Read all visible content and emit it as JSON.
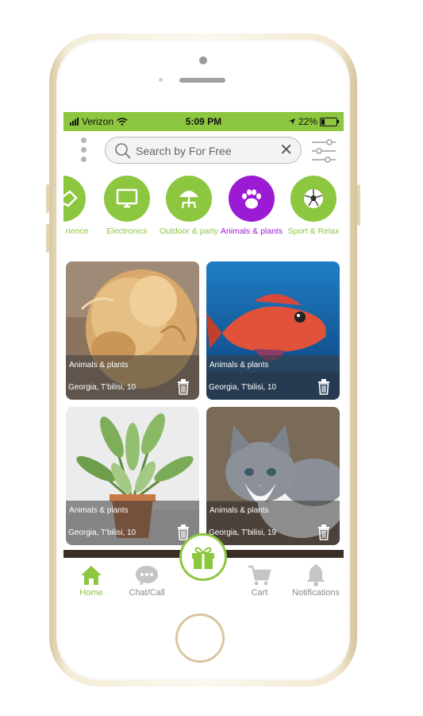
{
  "status_bar": {
    "carrier": "Verizon",
    "time": "5:09 PM",
    "battery": "22%"
  },
  "search": {
    "placeholder": "Search by For Free"
  },
  "categories": [
    {
      "label": "edge & rience",
      "icon": "handshake-icon",
      "active": false
    },
    {
      "label": "Electronics",
      "icon": "monitor-icon",
      "active": false
    },
    {
      "label": "Outdoor & party",
      "icon": "parasol-table-icon",
      "active": false
    },
    {
      "label": "Animals & plants",
      "icon": "paw-icon",
      "active": true
    },
    {
      "label": "Sport & Relax",
      "icon": "soccer-ball-icon",
      "active": false
    }
  ],
  "listings": [
    {
      "category": "Animals & plants",
      "location": "Georgia, T'bilisi, 10",
      "image": "fluffy-cat-photo"
    },
    {
      "category": "Animals & plants",
      "location": "Georgia, T'bilisi, 10",
      "image": "red-fish-photo"
    },
    {
      "category": "Animals & plants",
      "location": "Georgia, T'bilisi, 10",
      "image": "potted-plant-photo"
    },
    {
      "category": "Animals & plants",
      "location": "Georgia, T'bilisi, 19",
      "image": "grey-kitten-photo"
    }
  ],
  "tabs": [
    {
      "label": "Home",
      "icon": "home-icon",
      "active": true
    },
    {
      "label": "Chat/Call",
      "icon": "chat-bubble-icon",
      "active": false
    },
    {
      "label": "Cart",
      "icon": "cart-icon",
      "active": false
    },
    {
      "label": "Notifications",
      "icon": "bell-icon",
      "active": false
    }
  ],
  "colors": {
    "brand_green": "#8dc63f",
    "active_purple": "#9b1bd4"
  }
}
